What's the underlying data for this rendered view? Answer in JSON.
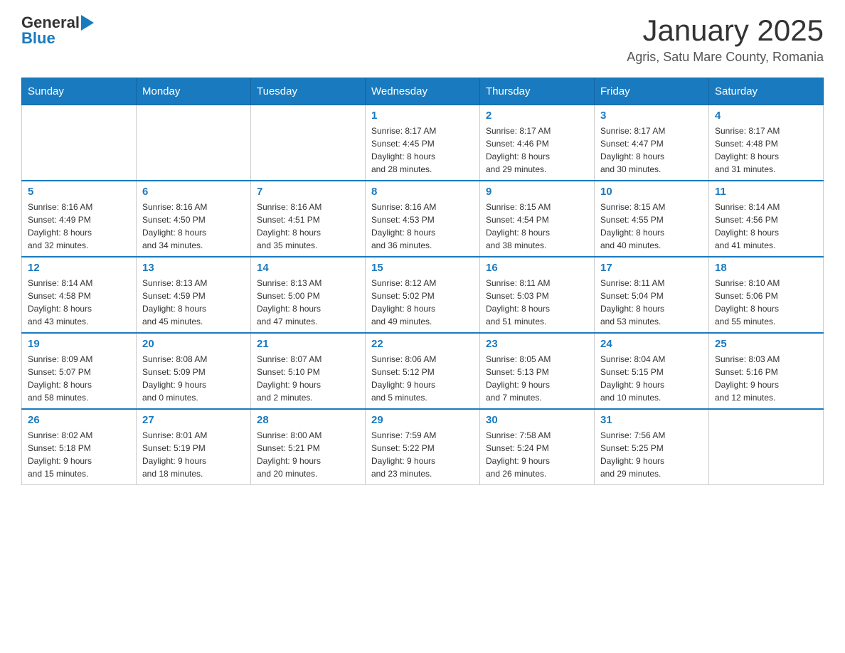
{
  "header": {
    "logo": {
      "text_general": "General",
      "text_blue": "Blue"
    },
    "title": "January 2025",
    "subtitle": "Agris, Satu Mare County, Romania"
  },
  "days_of_week": [
    "Sunday",
    "Monday",
    "Tuesday",
    "Wednesday",
    "Thursday",
    "Friday",
    "Saturday"
  ],
  "weeks": [
    [
      {
        "day": "",
        "info": ""
      },
      {
        "day": "",
        "info": ""
      },
      {
        "day": "",
        "info": ""
      },
      {
        "day": "1",
        "info": "Sunrise: 8:17 AM\nSunset: 4:45 PM\nDaylight: 8 hours\nand 28 minutes."
      },
      {
        "day": "2",
        "info": "Sunrise: 8:17 AM\nSunset: 4:46 PM\nDaylight: 8 hours\nand 29 minutes."
      },
      {
        "day": "3",
        "info": "Sunrise: 8:17 AM\nSunset: 4:47 PM\nDaylight: 8 hours\nand 30 minutes."
      },
      {
        "day": "4",
        "info": "Sunrise: 8:17 AM\nSunset: 4:48 PM\nDaylight: 8 hours\nand 31 minutes."
      }
    ],
    [
      {
        "day": "5",
        "info": "Sunrise: 8:16 AM\nSunset: 4:49 PM\nDaylight: 8 hours\nand 32 minutes."
      },
      {
        "day": "6",
        "info": "Sunrise: 8:16 AM\nSunset: 4:50 PM\nDaylight: 8 hours\nand 34 minutes."
      },
      {
        "day": "7",
        "info": "Sunrise: 8:16 AM\nSunset: 4:51 PM\nDaylight: 8 hours\nand 35 minutes."
      },
      {
        "day": "8",
        "info": "Sunrise: 8:16 AM\nSunset: 4:53 PM\nDaylight: 8 hours\nand 36 minutes."
      },
      {
        "day": "9",
        "info": "Sunrise: 8:15 AM\nSunset: 4:54 PM\nDaylight: 8 hours\nand 38 minutes."
      },
      {
        "day": "10",
        "info": "Sunrise: 8:15 AM\nSunset: 4:55 PM\nDaylight: 8 hours\nand 40 minutes."
      },
      {
        "day": "11",
        "info": "Sunrise: 8:14 AM\nSunset: 4:56 PM\nDaylight: 8 hours\nand 41 minutes."
      }
    ],
    [
      {
        "day": "12",
        "info": "Sunrise: 8:14 AM\nSunset: 4:58 PM\nDaylight: 8 hours\nand 43 minutes."
      },
      {
        "day": "13",
        "info": "Sunrise: 8:13 AM\nSunset: 4:59 PM\nDaylight: 8 hours\nand 45 minutes."
      },
      {
        "day": "14",
        "info": "Sunrise: 8:13 AM\nSunset: 5:00 PM\nDaylight: 8 hours\nand 47 minutes."
      },
      {
        "day": "15",
        "info": "Sunrise: 8:12 AM\nSunset: 5:02 PM\nDaylight: 8 hours\nand 49 minutes."
      },
      {
        "day": "16",
        "info": "Sunrise: 8:11 AM\nSunset: 5:03 PM\nDaylight: 8 hours\nand 51 minutes."
      },
      {
        "day": "17",
        "info": "Sunrise: 8:11 AM\nSunset: 5:04 PM\nDaylight: 8 hours\nand 53 minutes."
      },
      {
        "day": "18",
        "info": "Sunrise: 8:10 AM\nSunset: 5:06 PM\nDaylight: 8 hours\nand 55 minutes."
      }
    ],
    [
      {
        "day": "19",
        "info": "Sunrise: 8:09 AM\nSunset: 5:07 PM\nDaylight: 8 hours\nand 58 minutes."
      },
      {
        "day": "20",
        "info": "Sunrise: 8:08 AM\nSunset: 5:09 PM\nDaylight: 9 hours\nand 0 minutes."
      },
      {
        "day": "21",
        "info": "Sunrise: 8:07 AM\nSunset: 5:10 PM\nDaylight: 9 hours\nand 2 minutes."
      },
      {
        "day": "22",
        "info": "Sunrise: 8:06 AM\nSunset: 5:12 PM\nDaylight: 9 hours\nand 5 minutes."
      },
      {
        "day": "23",
        "info": "Sunrise: 8:05 AM\nSunset: 5:13 PM\nDaylight: 9 hours\nand 7 minutes."
      },
      {
        "day": "24",
        "info": "Sunrise: 8:04 AM\nSunset: 5:15 PM\nDaylight: 9 hours\nand 10 minutes."
      },
      {
        "day": "25",
        "info": "Sunrise: 8:03 AM\nSunset: 5:16 PM\nDaylight: 9 hours\nand 12 minutes."
      }
    ],
    [
      {
        "day": "26",
        "info": "Sunrise: 8:02 AM\nSunset: 5:18 PM\nDaylight: 9 hours\nand 15 minutes."
      },
      {
        "day": "27",
        "info": "Sunrise: 8:01 AM\nSunset: 5:19 PM\nDaylight: 9 hours\nand 18 minutes."
      },
      {
        "day": "28",
        "info": "Sunrise: 8:00 AM\nSunset: 5:21 PM\nDaylight: 9 hours\nand 20 minutes."
      },
      {
        "day": "29",
        "info": "Sunrise: 7:59 AM\nSunset: 5:22 PM\nDaylight: 9 hours\nand 23 minutes."
      },
      {
        "day": "30",
        "info": "Sunrise: 7:58 AM\nSunset: 5:24 PM\nDaylight: 9 hours\nand 26 minutes."
      },
      {
        "day": "31",
        "info": "Sunrise: 7:56 AM\nSunset: 5:25 PM\nDaylight: 9 hours\nand 29 minutes."
      },
      {
        "day": "",
        "info": ""
      }
    ]
  ]
}
